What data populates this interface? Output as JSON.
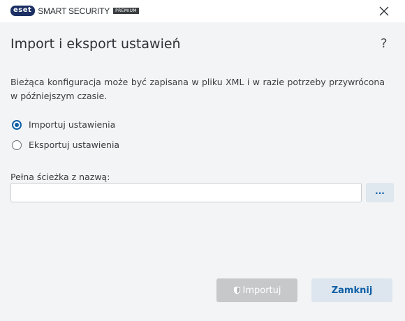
{
  "titlebar": {
    "logo_text": "eset",
    "product_name": "SMART SECURITY",
    "badge": "PREMIUM",
    "close_icon": "close-icon"
  },
  "header": {
    "title": "Import i eksport ustawień",
    "help_label": "?"
  },
  "description": "Bieżąca konfiguracja może być zapisana w pliku XML i w razie potrzeby przywrócona w późniejszym czasie.",
  "options": [
    {
      "label": "Importuj ustawienia",
      "selected": true
    },
    {
      "label": "Eksportuj ustawienia",
      "selected": false
    }
  ],
  "path": {
    "label": "Pełna ścieżka z nazwą:",
    "value": "",
    "browse_label": "..."
  },
  "buttons": {
    "import_label": "Importuj",
    "import_icon": "shield-icon",
    "close_label": "Zamknij"
  },
  "colors": {
    "accent": "#0d5ea6",
    "background": "#f2f4f6",
    "disabled_button": "#c6c8ca"
  }
}
